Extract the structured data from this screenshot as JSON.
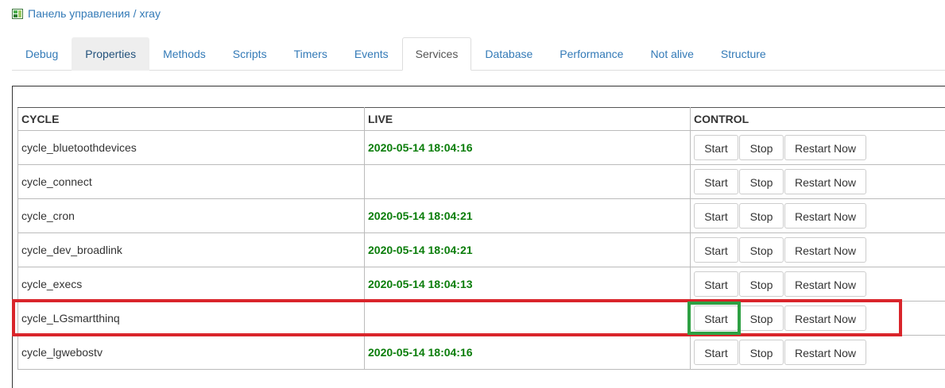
{
  "breadcrumb": {
    "root": "Панель управления",
    "separator": "/",
    "current": "xray"
  },
  "tabs": [
    {
      "label": "Debug",
      "state": "normal"
    },
    {
      "label": "Properties",
      "state": "hover"
    },
    {
      "label": "Methods",
      "state": "normal"
    },
    {
      "label": "Scripts",
      "state": "normal"
    },
    {
      "label": "Timers",
      "state": "normal"
    },
    {
      "label": "Events",
      "state": "normal"
    },
    {
      "label": "Services",
      "state": "active"
    },
    {
      "label": "Database",
      "state": "normal"
    },
    {
      "label": "Performance",
      "state": "normal"
    },
    {
      "label": "Not alive",
      "state": "normal"
    },
    {
      "label": "Structure",
      "state": "normal"
    }
  ],
  "table": {
    "headers": {
      "cycle": "CYCLE",
      "live": "LIVE",
      "control": "CONTROL"
    },
    "buttons": {
      "start": "Start",
      "stop": "Stop",
      "restart": "Restart Now"
    },
    "rows": [
      {
        "cycle": "cycle_bluetoothdevices",
        "live": "2020-05-14 18:04:16"
      },
      {
        "cycle": "cycle_connect",
        "live": ""
      },
      {
        "cycle": "cycle_cron",
        "live": "2020-05-14 18:04:21"
      },
      {
        "cycle": "cycle_dev_broadlink",
        "live": "2020-05-14 18:04:21"
      },
      {
        "cycle": "cycle_execs",
        "live": "2020-05-14 18:04:13"
      },
      {
        "cycle": "cycle_LGsmartthinq",
        "live": ""
      },
      {
        "cycle": "cycle_lgwebostv",
        "live": "2020-05-14 18:04:16"
      }
    ]
  },
  "colors": {
    "link": "#337ab7",
    "live_text": "#0a7d0a",
    "highlight_row": "#d9252b",
    "highlight_button": "#2ea043"
  },
  "icons": {
    "breadcrumb": "control-panel-icon"
  }
}
